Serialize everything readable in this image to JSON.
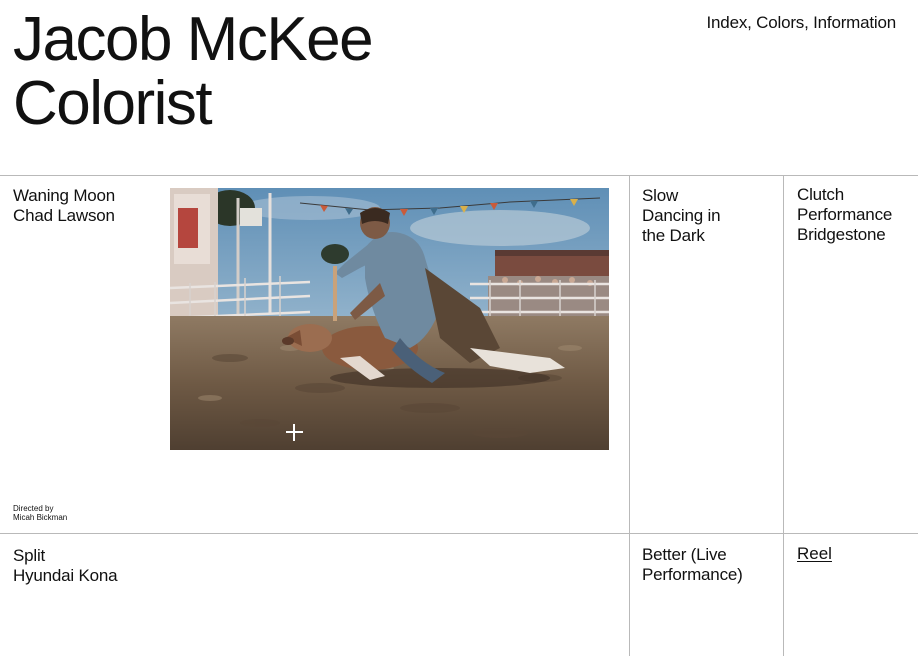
{
  "header": {
    "title_line1": "Jacob McKee",
    "title_line2": "Colorist",
    "nav": [
      "Index",
      "Colors",
      "Information"
    ]
  },
  "projects": [
    {
      "title": "Waning Moon",
      "client": "Chad Lawson"
    },
    {
      "title_lines": [
        "Slow",
        "Dancing in",
        "the Dark"
      ]
    },
    {
      "title_lines": [
        "Clutch",
        "Performance",
        "Bridgestone"
      ]
    },
    {
      "title": "Split",
      "client": "Hyundai Kona"
    },
    {
      "title_lines": [
        "Better (Live",
        "Performance)"
      ]
    }
  ],
  "credit": {
    "label": "Directed by",
    "name": "Micah Bickman"
  },
  "reel_label": "Reel",
  "preview": {
    "icon": "crosshair-icon"
  },
  "colors": {
    "text": "#111111",
    "divider": "#b9b9b9",
    "background": "#ffffff"
  }
}
